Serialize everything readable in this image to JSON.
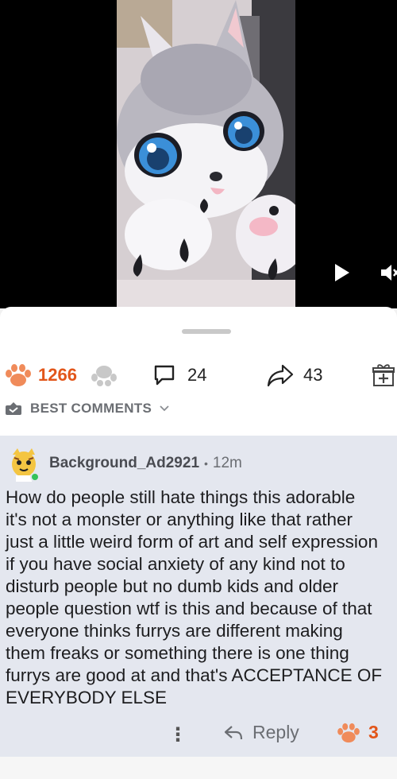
{
  "post": {
    "upvotes": "1266",
    "comments": "24",
    "shares": "43",
    "sort_label": "BEST COMMENTS"
  },
  "comment": {
    "author": "Background_Ad2921",
    "time": "12m",
    "body": "How do people still hate things this adorable\nit's not a monster or anything like that rather\njust a little weird form of art and self expression\nif you have social anxiety of any kind not to\ndisturb people but no dumb kids and older\npeople question wtf is this and because of that\neveryone thinks furrys are different making\nthem freaks or something there is one thing\nfurrys are good at and that's ACCEPTANCE OF\nEVERYBODY ELSE",
    "reply_label": "Reply",
    "upvotes": "3"
  },
  "colors": {
    "upvote_accent": "#e2561a",
    "comment_bg": "#e4e7ef"
  },
  "icons": [
    "play-icon",
    "volume-icon",
    "paw-upvote-icon",
    "paw-downvote-icon",
    "comment-icon",
    "share-icon",
    "gift-icon",
    "best-comments-icon",
    "chevron-down-icon",
    "more-icon",
    "reply-icon"
  ]
}
